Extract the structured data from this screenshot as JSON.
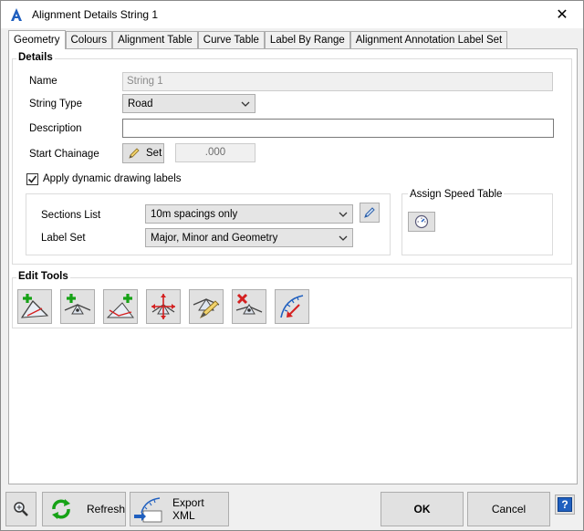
{
  "window": {
    "title": "Alignment Details String 1",
    "close_glyph": "✕"
  },
  "tabs": [
    {
      "label": "Geometry",
      "active": true
    },
    {
      "label": "Colours"
    },
    {
      "label": "Alignment Table"
    },
    {
      "label": "Curve Table"
    },
    {
      "label": "Label By Range"
    },
    {
      "label": "Alignment Annotation Label Set"
    }
  ],
  "details": {
    "group_label": "Details",
    "name_label": "Name",
    "name_value": "String 1",
    "string_type_label": "String Type",
    "string_type_value": "Road",
    "description_label": "Description",
    "description_value": "",
    "start_chainage_label": "Start Chainage",
    "set_label": "Set",
    "chainage_value": ".000",
    "apply_labels_text": "Apply dynamic drawing labels",
    "apply_labels_checked": true,
    "sections_list_label": "Sections List",
    "sections_list_value": "10m spacings only",
    "label_set_label": "Label Set",
    "label_set_value": "Major, Minor and Geometry",
    "speed_table_label": "Assign Speed Table"
  },
  "edit_tools": {
    "group_label": "Edit Tools",
    "tools": [
      "add-ip-icon",
      "insert-ip-icon",
      "add-ip-after-icon",
      "move-ip-icon",
      "edit-ip-icon",
      "delete-ip-icon",
      "reverse-direction-icon"
    ]
  },
  "footer": {
    "refresh_label": "Refresh",
    "export_label": "Export XML",
    "ok_label": "OK",
    "cancel_label": "Cancel",
    "help_glyph": "?"
  },
  "colors": {
    "accent_blue": "#1f5fbf",
    "add_green": "#16a216",
    "delete_red": "#d42020"
  }
}
